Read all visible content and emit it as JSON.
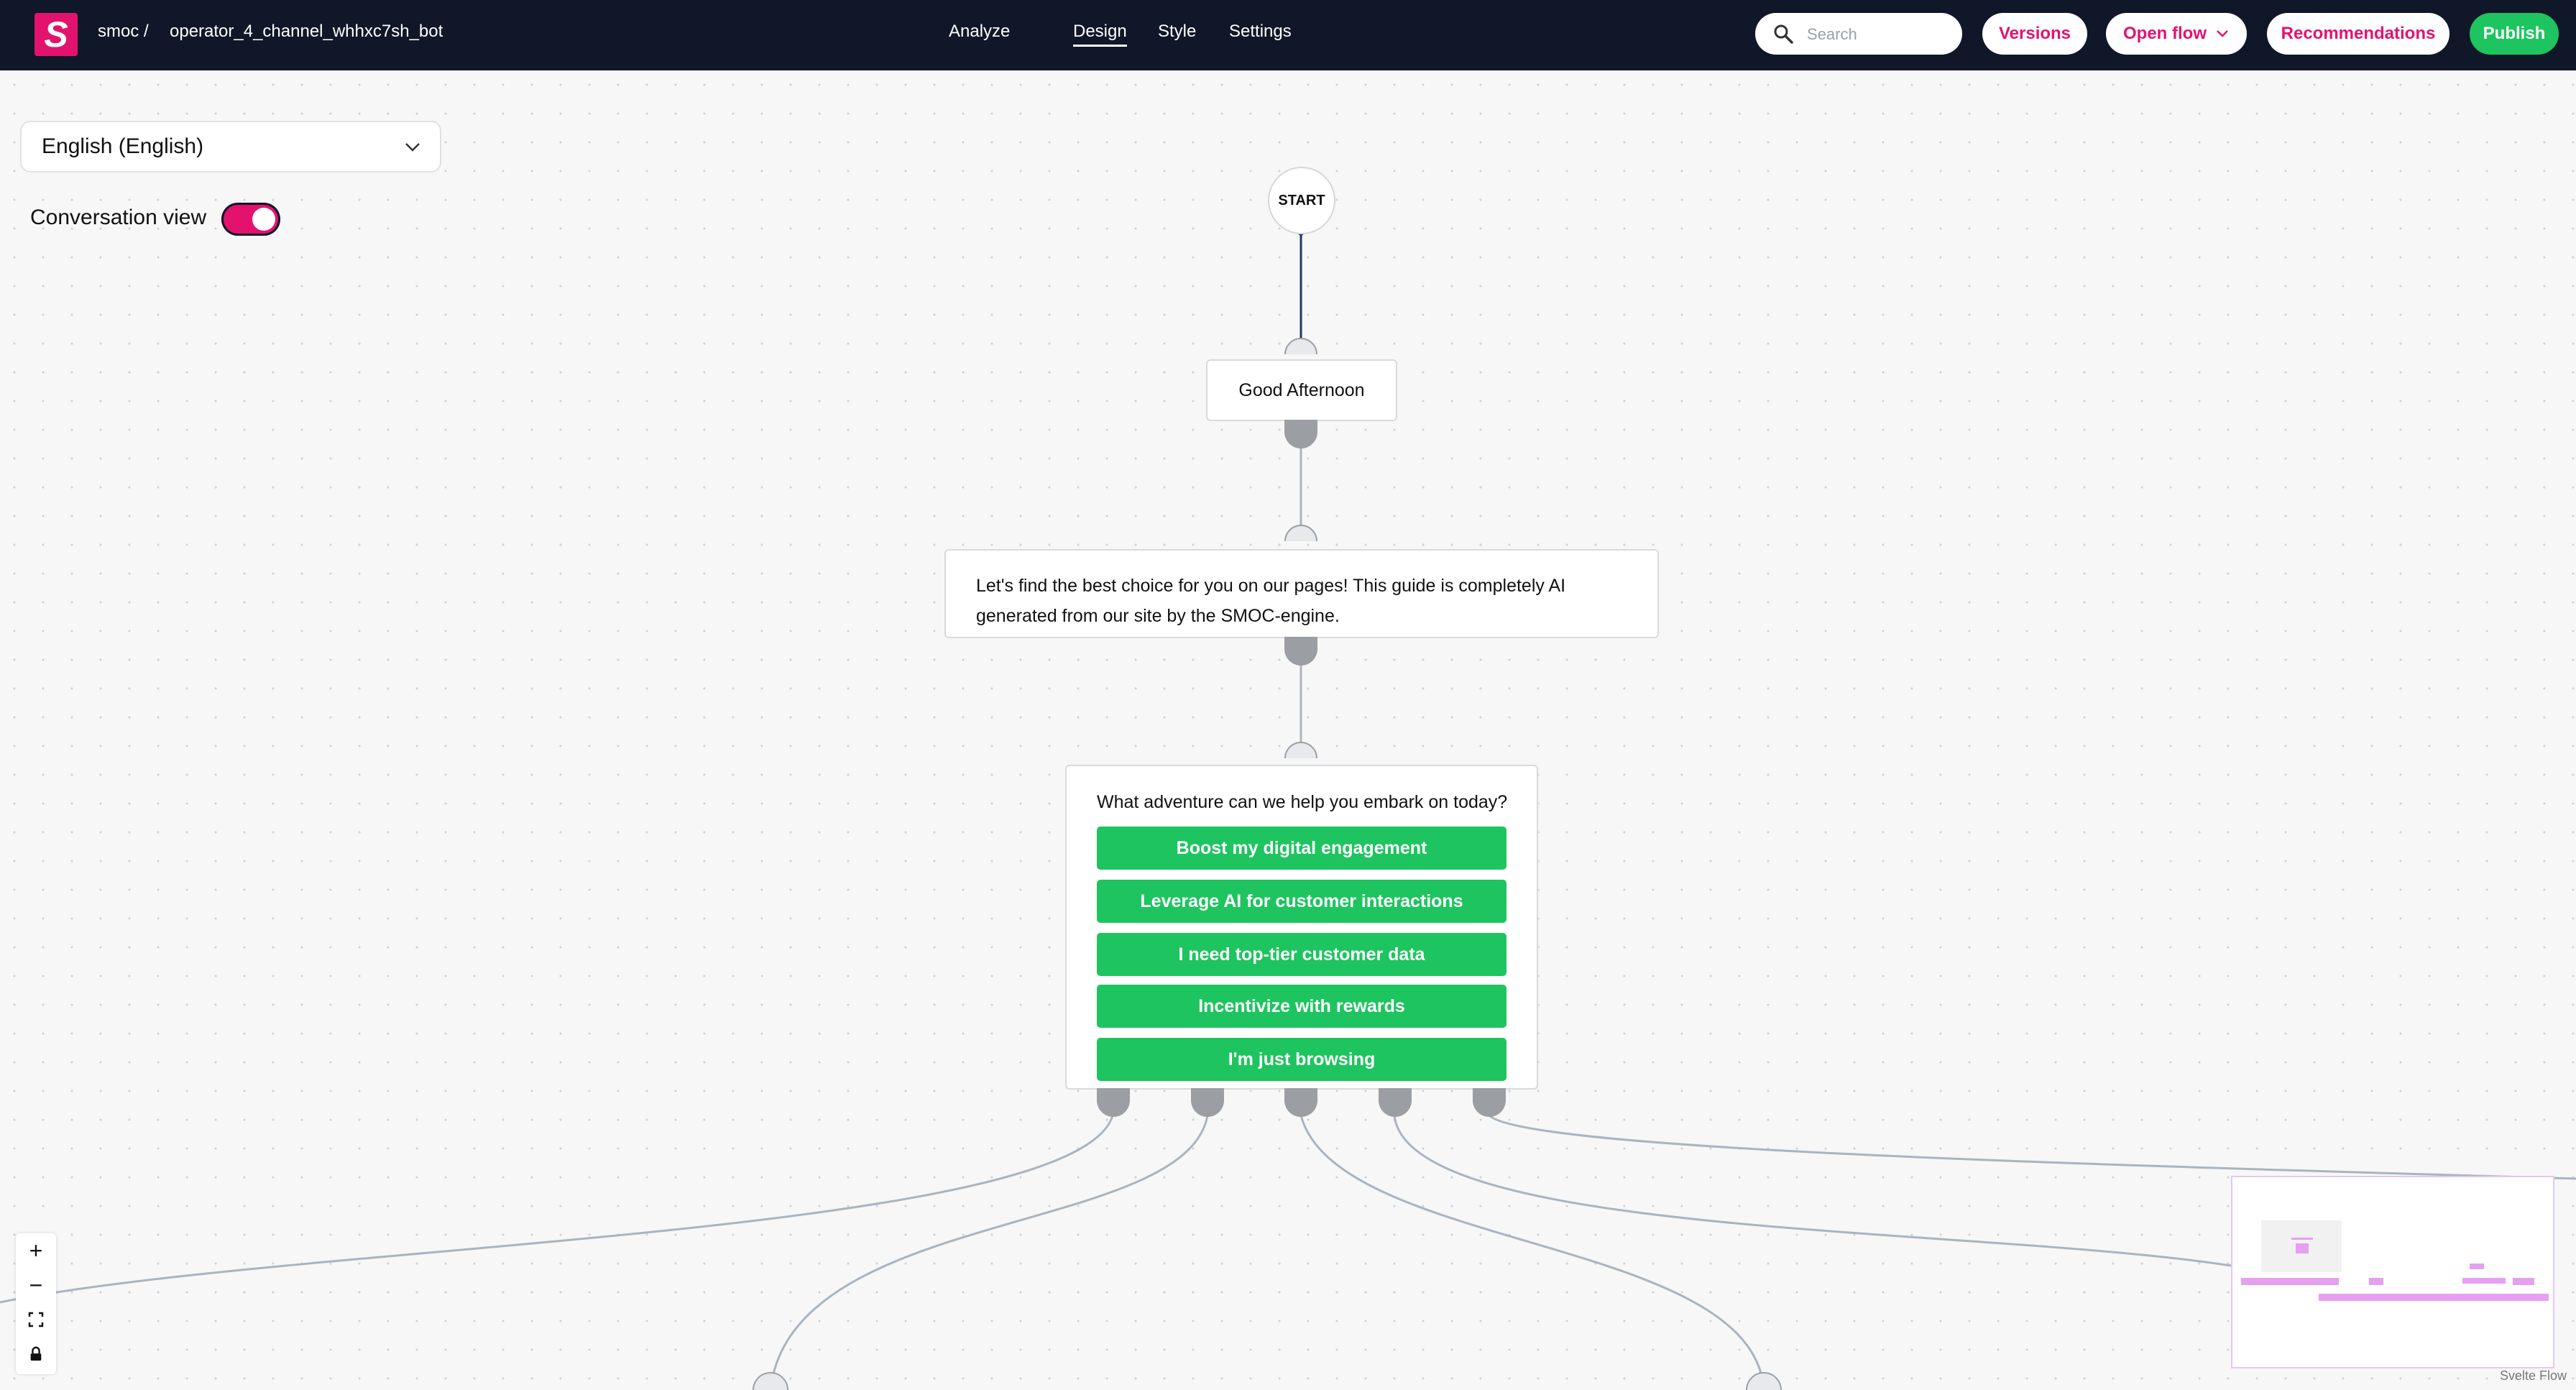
{
  "app": {
    "logo_letter": "S",
    "org": "smoc /",
    "bot_name": "operator_4_channel_whhxc7sh_bot"
  },
  "nav": {
    "analyze": "Analyze",
    "design": "Design",
    "style": "Style",
    "settings": "Settings",
    "active": "Design"
  },
  "search": {
    "placeholder": "Search"
  },
  "actions": {
    "versions": "Versions",
    "open_flow": "Open flow",
    "recommendations": "Recommendations",
    "publish": "Publish"
  },
  "language": {
    "selected": "English (English)"
  },
  "conversation_view": {
    "label": "Conversation view",
    "enabled": true
  },
  "flow": {
    "start": "START",
    "greeting": "Good Afternoon",
    "intro": "Let's find the best choice for you on our pages! This guide is completely AI generated from our site by the SMOC-engine.",
    "question": "What adventure can we help you embark on today?",
    "choices": [
      "Boost my digital engagement",
      "Leverage AI for customer interactions",
      "I need top-tier customer data",
      "Incentivize with rewards",
      "I'm just browsing"
    ]
  },
  "controls": {
    "zoom_in": "+",
    "zoom_out": "−",
    "fit_view": "fit-view-icon",
    "lock": "lock-icon"
  },
  "minimap": {
    "attribution": "Svelte Flow"
  },
  "colors": {
    "brand": "#e3126f",
    "topbar": "#0f1728",
    "choice_green": "#1ec45f",
    "edge": "#a9b4bf"
  }
}
